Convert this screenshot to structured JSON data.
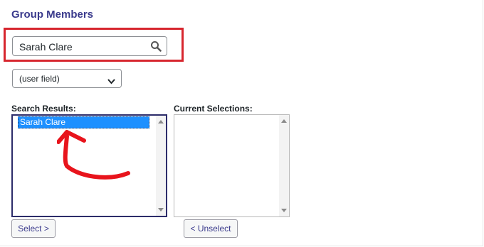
{
  "section": {
    "title": "Group Members"
  },
  "search": {
    "value": "Sarah Clare",
    "icon": "search-icon"
  },
  "field_select": {
    "selected": "(user field)",
    "icon": "chevron-down-icon"
  },
  "results": {
    "label": "Search Results:",
    "items": [
      "Sarah Clare"
    ],
    "select_button": "Select >"
  },
  "current": {
    "label": "Current Selections:",
    "items": [],
    "unselect_button": "< Unselect"
  },
  "colors": {
    "accent": "#3a3a8c",
    "highlight_border": "#d7262e",
    "selected_option": "#1e90ff"
  }
}
